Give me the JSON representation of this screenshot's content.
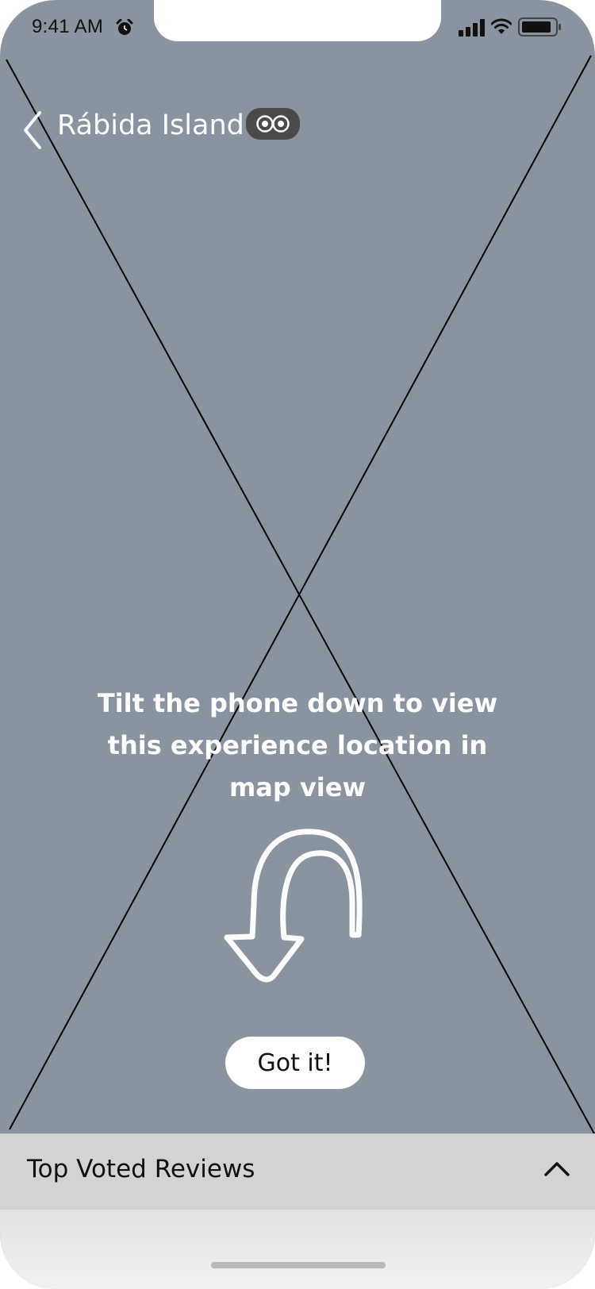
{
  "status_bar": {
    "time": "9:41 AM",
    "icons": [
      "alarm-icon",
      "signal-icon",
      "wifi-icon",
      "battery-icon"
    ]
  },
  "nav": {
    "back_icon": "chevron-left-icon",
    "title": "Rábida Island",
    "badge_icon": "vr-goggles-icon"
  },
  "content": {
    "instruction_lines": [
      "Tilt the phone down to view",
      "this experience location in",
      "map view"
    ],
    "arrow_icon": "curved-down-arrow-icon",
    "button_label": "Got it!"
  },
  "reviews": {
    "label": "Top Voted Reviews",
    "toggle_icon": "chevron-up-icon"
  },
  "colors": {
    "background": "#8a94a0",
    "text_light": "#ffffff",
    "drawer": "#d3d3d3",
    "badge": "#4a4a4a"
  }
}
